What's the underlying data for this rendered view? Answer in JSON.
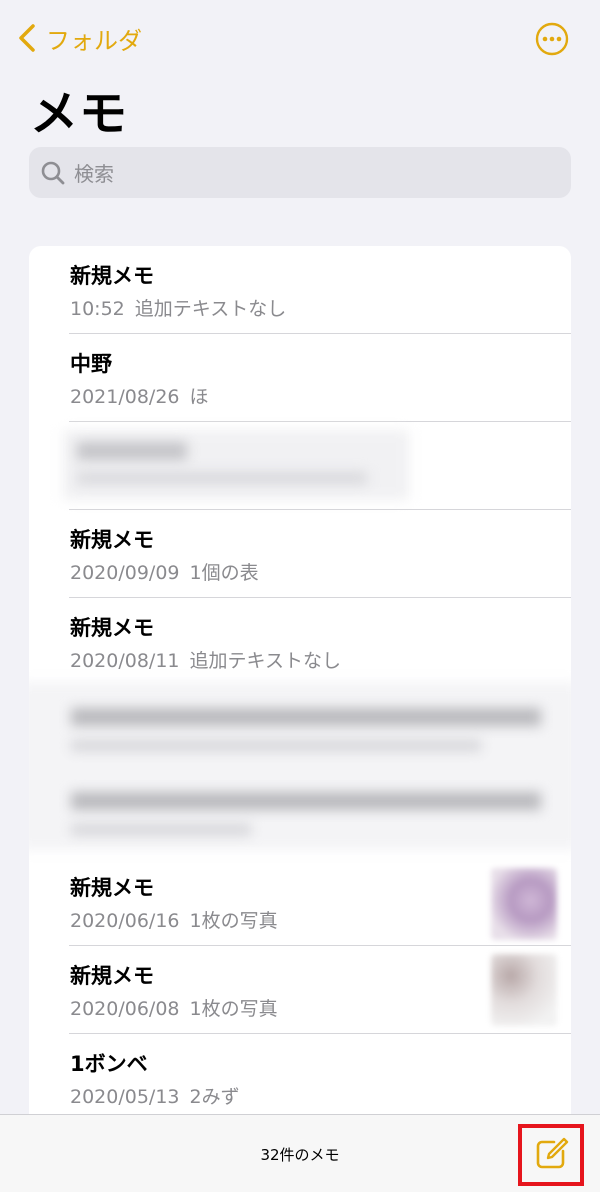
{
  "nav": {
    "back_label": "フォルダ",
    "back_icon": "chevron-left-icon",
    "more_icon": "ellipsis-circle-icon"
  },
  "title": "メモ",
  "search": {
    "placeholder": "検索",
    "icon": "search-icon"
  },
  "notes": [
    {
      "title": "新規メモ",
      "date": "10:52",
      "preview": "追加テキストなし"
    },
    {
      "title": "中野",
      "date": "2021/08/26",
      "preview": "ほ"
    },
    {
      "title": "新規メモ",
      "date": "2020/09/09",
      "preview": "1個の表"
    },
    {
      "title": "新規メモ",
      "date": "2020/08/11",
      "preview": "追加テキストなし"
    },
    {
      "title": "新規メモ",
      "date": "2020/06/16",
      "preview": "1枚の写真"
    },
    {
      "title": "新規メモ",
      "date": "2020/06/08",
      "preview": "1枚の写真"
    },
    {
      "title": "1ボンベ",
      "date": "2020/05/13",
      "preview": "2みず"
    }
  ],
  "footer": {
    "count_label": "32件のメモ",
    "compose_icon": "compose-icon"
  },
  "colors": {
    "accent": "#e2a90e",
    "highlight": "#e6151d",
    "background": "#f2f2f7"
  }
}
